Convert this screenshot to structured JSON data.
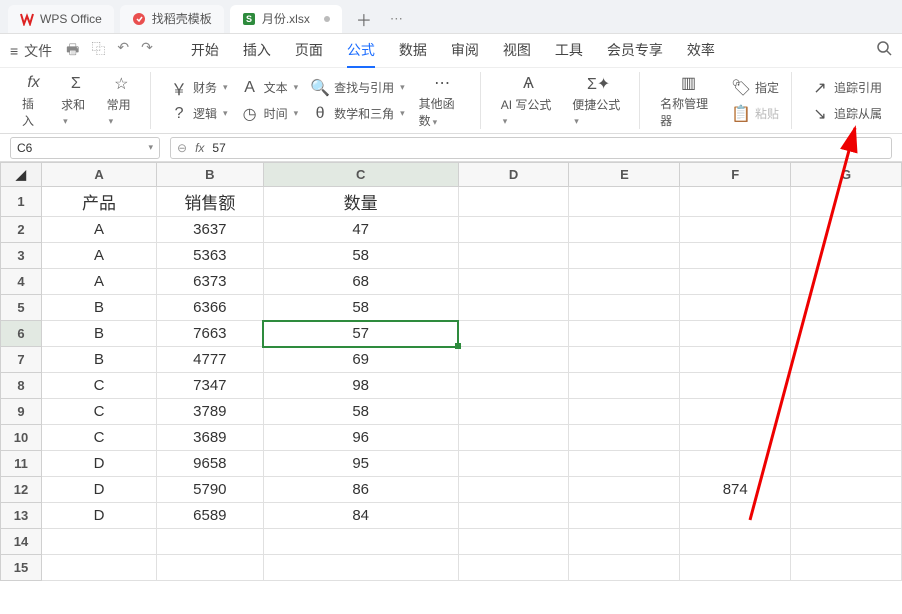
{
  "tabs": {
    "wps_office": "WPS Office",
    "templates": "找稻壳模板",
    "file": "月份.xlsx"
  },
  "menu": {
    "file": "文件",
    "items": [
      "开始",
      "插入",
      "页面",
      "公式",
      "数据",
      "审阅",
      "视图",
      "工具",
      "会员专享",
      "效率"
    ],
    "active_index": 3
  },
  "ribbon": {
    "fx": "fx",
    "insert": "插入",
    "sum": "求和",
    "common": "常用",
    "finance": "财务",
    "text": "文本",
    "lookup": "查找与引用",
    "logic": "逻辑",
    "time": "时间",
    "math": "数学和三角",
    "other": "其他函数",
    "ai": "AI 写公式",
    "quick": "便捷公式",
    "name_mgr": "名称管理器",
    "specify": "指定",
    "paste": "粘贴",
    "trace_precedents": "追踪引用",
    "trace_dependents": "追踪从属"
  },
  "formula_bar": {
    "cell_ref": "C6",
    "value": "57"
  },
  "columns": [
    "A",
    "B",
    "C",
    "D",
    "E",
    "F",
    "G"
  ],
  "row_numbers": [
    1,
    2,
    3,
    4,
    5,
    6,
    7,
    8,
    9,
    10,
    11,
    12,
    13,
    14,
    15
  ],
  "selected": {
    "row": 6,
    "col": "C"
  },
  "table": {
    "headers": {
      "A": "产品",
      "B": "销售额",
      "C": "数量"
    },
    "rows": [
      {
        "A": "A",
        "B": "3637",
        "C": "47"
      },
      {
        "A": "A",
        "B": "5363",
        "C": "58"
      },
      {
        "A": "A",
        "B": "6373",
        "C": "68"
      },
      {
        "A": "B",
        "B": "6366",
        "C": "58"
      },
      {
        "A": "B",
        "B": "7663",
        "C": "57"
      },
      {
        "A": "B",
        "B": "4777",
        "C": "69"
      },
      {
        "A": "C",
        "B": "7347",
        "C": "98"
      },
      {
        "A": "C",
        "B": "3789",
        "C": "58"
      },
      {
        "A": "C",
        "B": "3689",
        "C": "96"
      },
      {
        "A": "D",
        "B": "9658",
        "C": "95"
      },
      {
        "A": "D",
        "B": "5790",
        "C": "86",
        "F": "874"
      },
      {
        "A": "D",
        "B": "6589",
        "C": "84"
      }
    ]
  }
}
